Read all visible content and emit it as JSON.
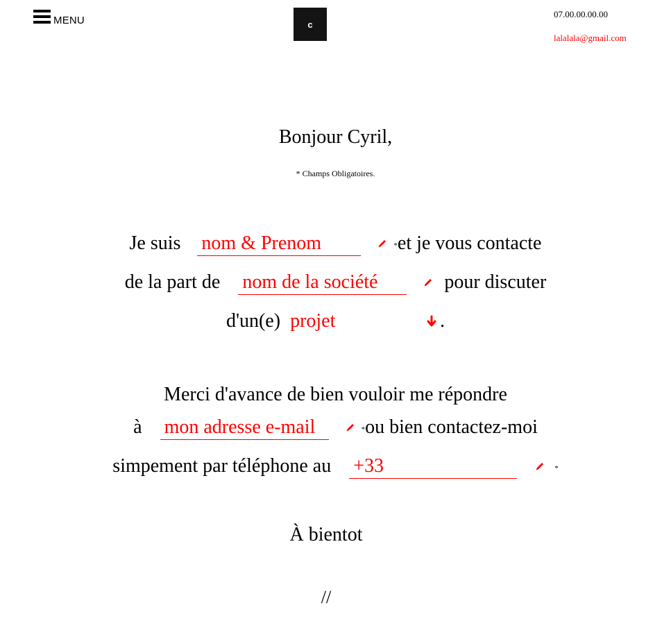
{
  "header": {
    "menu_label": "MENU",
    "logo_letter": "c",
    "phone": "07.00.00.00.00",
    "email": "lalalala@gmail.com"
  },
  "intro": {
    "greeting": "Bonjour Cyril,",
    "required_note": "* Champs Obligatoires."
  },
  "form": {
    "line1_prefix": "Je suis",
    "name_placeholder": "nom & Prenom",
    "line1_suffix": "et je vous contacte",
    "line2_prefix": "de la part de",
    "company_placeholder": "nom de la société",
    "line2_suffix": "pour discuter",
    "line3_prefix": "d'un(e)",
    "subject_value": "projet",
    "line3_suffix": ".",
    "line4_text": "Merci d'avance de bien vouloir me répondre",
    "line5_prefix": "à",
    "email_placeholder": "mon adresse e-mail",
    "line5_suffix": "ou bien contactez-moi",
    "line6_prefix": "simpement par téléphone au",
    "phone_value": "+33",
    "required_mark": "*"
  },
  "closing": {
    "sign_off": "À bientot",
    "submit_label": "//"
  },
  "colors": {
    "accent": "#ff0000",
    "logo_bg": "#141414",
    "text": "#000000"
  },
  "icons": [
    "hamburger-icon",
    "pencil-icon",
    "arrow-down-icon"
  ]
}
